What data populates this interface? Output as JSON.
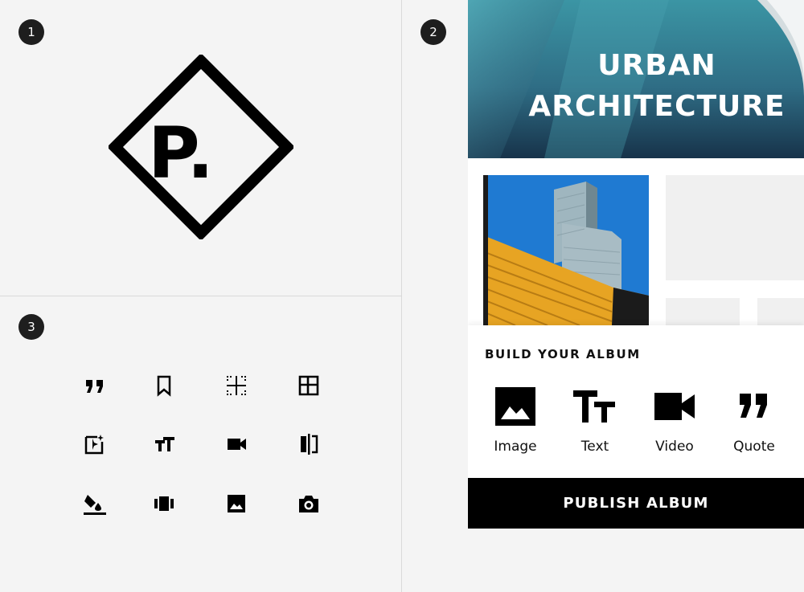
{
  "badges": {
    "one": "1",
    "two": "2",
    "three": "3"
  },
  "logo": {
    "letter": "P."
  },
  "icon_grid": [
    "format-quote-icon",
    "bookmark-icon",
    "grid-dotted-icon",
    "grid-icon",
    "auto-fix-image-icon",
    "text-size-icon",
    "videocam-icon",
    "compare-icon",
    "paint-bucket-icon",
    "carousel-icon",
    "image-icon",
    "camera-icon"
  ],
  "album": {
    "hero_line1": "URBAN",
    "hero_line2": "ARCHITECTURE",
    "build_title": "BUILD YOUR ALBUM",
    "tools": [
      {
        "label": "Image",
        "icon": "image-icon"
      },
      {
        "label": "Text",
        "icon": "text-size-icon"
      },
      {
        "label": "Video",
        "icon": "videocam-icon"
      },
      {
        "label": "Quote",
        "icon": "format-quote-icon"
      }
    ],
    "publish_label": "PUBLISH ALBUM"
  },
  "colors": {
    "background": "#f4f4f4",
    "ink": "#000000",
    "badge": "#1e1e1e",
    "placeholder": "#f0f0f0",
    "accent_yellow": "#e7a423",
    "sky": "#1d7bd0"
  }
}
